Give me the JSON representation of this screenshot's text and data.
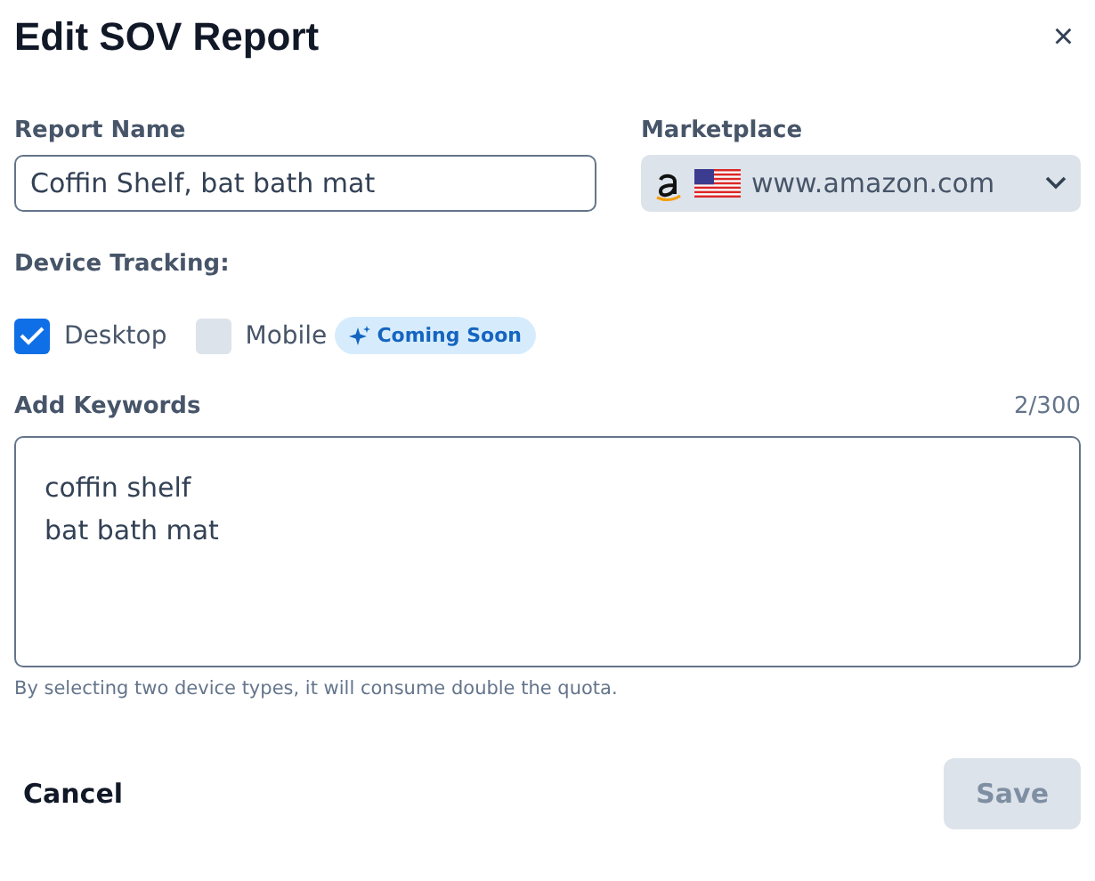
{
  "dialog": {
    "title": "Edit SOV Report",
    "close": "×"
  },
  "report_name": {
    "label": "Report Name",
    "value": "Coffin Shelf, bat bath mat"
  },
  "marketplace": {
    "label": "Marketplace",
    "value": "www.amazon.com"
  },
  "device_tracking": {
    "label": "Device Tracking:",
    "options": [
      {
        "label": "Desktop",
        "checked": true
      },
      {
        "label": "Mobile",
        "checked": false,
        "badge": "Coming Soon"
      }
    ]
  },
  "keywords": {
    "label": "Add Keywords",
    "count": "2/300",
    "lines": [
      "coffin shelf",
      "bat bath mat"
    ],
    "hint": "By selecting two device types, it will consume double the quota."
  },
  "buttons": [
    {
      "label": "Cancel",
      "kind": "text"
    },
    {
      "label": "Save",
      "kind": "primary",
      "disabled": true
    }
  ]
}
